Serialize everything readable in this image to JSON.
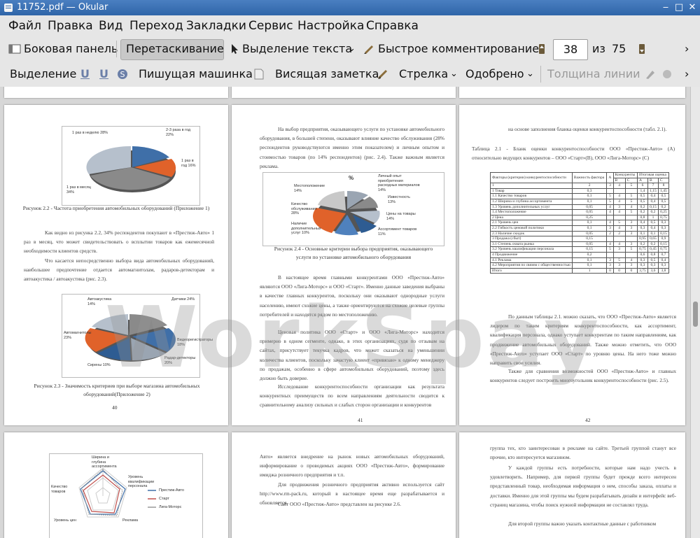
{
  "window": {
    "title": "11752.pdf — Okular"
  },
  "menu": [
    "Файл",
    "Правка",
    "Вид",
    "Переход",
    "Закладки",
    "Сервис",
    "Настройка",
    "Справка"
  ],
  "toolbar1": {
    "sidebar": "Боковая панель",
    "drag": "Перетаскивание",
    "text_select": "Выделение текста",
    "quick_comment": "Быстрое комментирование",
    "page_current": "38",
    "page_of": "из",
    "page_total": "75"
  },
  "toolbar2": {
    "select": "Выделение",
    "typewriter": "Пишущая машинка",
    "sticky_note": "Висящая заметка",
    "arrow": "Стрелка",
    "approved": "Одобрено",
    "line_width": "Толщина линии"
  },
  "pages": {
    "p40": {
      "fig22_caption": "Рисунок 2.2 - Частота приобретения автомобильных оборудований (Приложение 1)",
      "pie1_labels": [
        "1 раз в неделю 28%",
        "2-3 раза в год 22%",
        "1 раз в год 16%",
        "1 раз в месяц 34%"
      ],
      "para1": "Как видно из рисунка 2.2, 34% респондентов покупают в «Престиж-Авто» 1 раз в месяц, что может свидетельствовать о всплытии товаров как ежемесячной необходимости клиентов средств.",
      "para2": "Что касается непосредственно выбора вида автомобильных оборудований, наибольшее предпочтение отдается автомагнитолам, радаров-детекторам и автоакустика / автоакустика (рис. 2.3).",
      "pie2_labels": [
        "Автоакустика 14%",
        "Датчики 24%",
        "Автомагнитолы 23%",
        "Сирены 10%",
        "Радар-детекторы 20%",
        "Видеорегистраторы 18%"
      ],
      "fig23_caption": "Рисунок 2.3 - Значимость критериев при выборе магазина автомобильных оборудований(Приложение 2)",
      "num": "40"
    },
    "p41": {
      "para1": "На выбор предприятия, оказывающего услуги по установке автомобильного оборудования, в большей степени, оказывают влияние качество обслуживания (28% респондентов руководствуются именно этим показателем) и личным опытом и стоимостью товаров (по 14% респондентов) (рис. 2.4). Также важным является реклама.",
      "chart_title": "%",
      "pie_labels": [
        "Личный опыт приобретения расходных материалов 14%",
        "Известность 13%",
        "Цены на товары 14%",
        "Ассортимент товаров 11%",
        "Наличие дополнительных услуг 10%",
        "Качество обслуживания 28%",
        "Местоположение 14%"
      ],
      "fig24_caption": "Рисунок 2.4 - Основные критерии выбора предприятия, оказывающего услуги по установке автомобильного оборудования",
      "para2": "В настоящее время главными конкурентами ООО «Престиж-Авто» являются ООО «Лига-Моторс» и ООО «Старт». Именно данные заведения выбраны в качестве главных конкурентов, поскольку они оказывают однородные услуги населению, имеют схожие цены, а также ориентируются на схожие целевые группы потребителей и находятся рядом по местоположению.",
      "para3": "Ценовая политика ООО «Старт» и ООО «Лига-Моторс» находится примерно в одном сегменте, однако, в этих организациях, судя по отзывам на сайтах, присутствует текучка кадров, что может сказаться на уменьшении количества клиентов, поскольку зачастую клиент «привязан» к одному менеджеру по продажам, особенно в сфере автомобильных оборудований, поэтому здесь должно быть доверие.",
      "para4": "Исследование конкурентоспособности организации как результата конкурентных преимуществ по всем направлениям деятельности сводится к сравнительному анализу сильных и слабых сторон организации и конкурентов",
      "num": "41"
    },
    "p42": {
      "para0": "на основе заполнения бланка оценки конкурентоспособности (табл. 2.1).",
      "table_title": "Таблица 2.1 - Бланк оценки конкурентоспособности ООО «Престиж-Авто» (А) относительно ведущих конкурентов – ООО «Старт»(В), ООО «Лига-Моторс» (С)",
      "table_header": [
        "Факторы (критерии) конкурентоспособности",
        "Важность фактора",
        "А",
        "Конкуренты",
        "Итоговая оценка"
      ],
      "table_subheader": [
        "",
        "",
        "",
        "B",
        "C",
        "A",
        "B",
        "C"
      ],
      "table_index_row": [
        "1",
        "2",
        "3",
        "4",
        "5",
        "6",
        "7",
        "8"
      ],
      "table_rows": [
        [
          "1 Товар",
          "0,3",
          "",
          "",
          "",
          "1,4",
          "1,15",
          "1,45"
        ],
        [
          "1.1 Качество товаров",
          "0,1",
          "5",
          "4",
          "5",
          "0,5",
          "0,4",
          "0,5"
        ],
        [
          "1.2 Ширина и глубина ассортимента",
          "0,1",
          "5",
          "4",
          "5",
          "0,5",
          "0,4",
          "0,5"
        ],
        [
          "1.3 Уровень дополнительных услуг",
          "0,05",
          "4",
          "3",
          "4",
          "0,2",
          "0,15",
          "0,2"
        ],
        [
          "1.4 Местоположение",
          "0,05",
          "4",
          "4",
          "5",
          "0,2",
          "0,2",
          "0,25"
        ],
        [
          "2 Цена",
          "0,25",
          "",
          "",
          "",
          "0,8",
          "1",
          "0,75"
        ],
        [
          "2.1 Уровень цен",
          "0,1",
          "4",
          "5",
          "3",
          "0,4",
          "0,5",
          "0,3"
        ],
        [
          "2.2 Гибкость ценовой политики",
          "0,1",
          "3",
          "4",
          "3",
          "0,3",
          "0,4",
          "0,3"
        ],
        [
          "2.3 Наличие скидок",
          "0,05",
          "2",
          "2",
          "3",
          "0,1",
          "0,1",
          "0,15"
        ],
        [
          "3 Продажа (сбыт)",
          "0,15",
          "",
          "",
          "",
          "0,95",
          "0,65",
          "0,9"
        ],
        [
          "3.1 Степень охвата рынка",
          "0,05",
          "4",
          "4",
          "3",
          "0,2",
          "0,2",
          "0,15"
        ],
        [
          "3.2 Уровень квалификации персонала",
          "0,15",
          "5",
          "3",
          "5",
          "0,75",
          "0,45",
          "0,75"
        ],
        [
          "4 Продвижение",
          "0,2",
          "",
          "",
          "",
          "0,6",
          "0,8",
          "0,7"
        ],
        [
          "4.1 Реклама",
          "0,1",
          "3",
          "5",
          "4",
          "0,3",
          "0,5",
          "0,4"
        ],
        [
          "4.2 Мероприятия по связям с общественностью",
          "0,1",
          "3",
          "3",
          "3",
          "0,3",
          "0,3",
          "0,3"
        ],
        [
          "Итого",
          "1",
          "0",
          "0",
          "0",
          "3,75",
          "3,6",
          "3,8"
        ]
      ],
      "para1": "По данным таблицы 2.1. можно сказать, что ООО «Престиж-Авто» является лидером по таким критериям конкурентоспособности, как ассортимент, квалификация персонала, однако уступает конкурентам по таким направлениям, как продвижение автомобильных оборудований. Также можно отметить, что ООО «Престиж-Авто» уступает ООО «Старт» по уровню цены. На него тоже можно направить свои усилия.",
      "para2": "Также для сравнения возможностей ООО «Престиж-Авто» и главных конкурентов следует построить многоугольник конкурентоспособности (рис. 2.5).",
      "num": "42"
    },
    "p43": {
      "radar_axes": [
        "Ширина и глубина ассортимента",
        "Уровень квалификации персонала",
        "Реклама",
        "Уровень цен",
        "Качество товаров"
      ],
      "legend": [
        "Престиж-Авто",
        "Старт",
        "Лига-Моторс"
      ]
    },
    "p44": {
      "para1": "Авто» является внедрение на рынок новых автомобильных оборудований, информирование о проводимых акциях ООО «Престиж-Авто», формирование имиджа розничного предприятия и т.п.",
      "para2": "Для продвижения розничного предприятия активно используется сайт http://www.rm-pack.ru, который в настоящее время еще разрабатывается и обновляется.",
      "para3": "Сайт ООО «Престиж-Авто» представлен на рисунке 2.6."
    },
    "p45": {
      "para1": "группа тех, кто заинтересован в рекламе на сайте. Третьей группой станут все прочие, кто интересуется магазином.",
      "para2": "У каждой группы есть потребности, которые нам надо учесть в удовлетворить. Например, для первой группы будет прежде всего интересен представленный товар, необходимая информация о нем, способы заказа, оплаты и доставки. Именно для этой группы мы будем разрабатывать дизайн и интерфейс веб-страниц магазина, чтобы поиск нужной информации не составлял труда.",
      "para3": "Для второй группы важно указать контактные данные с работником"
    }
  },
  "watermark": "WorkSpay",
  "colors": {
    "titlebar": "#3a70b4",
    "pie_blue": "#4f81bd",
    "pie_orange": "#e0622a",
    "pie_grey": "#8c8c8c"
  }
}
